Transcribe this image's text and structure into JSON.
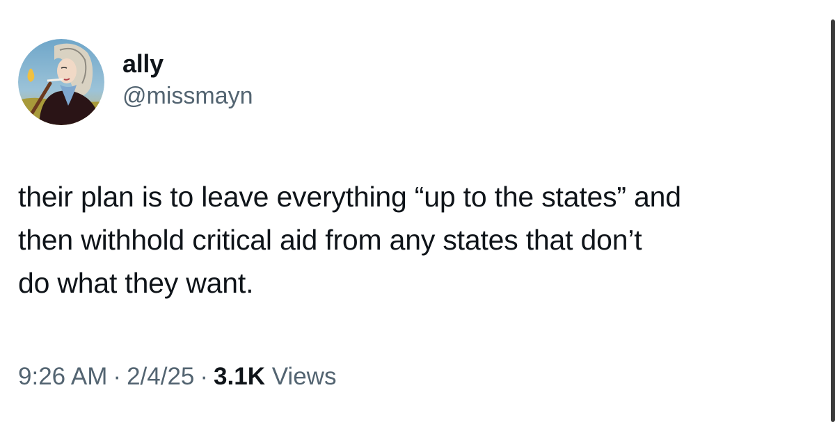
{
  "author": {
    "display_name": "ally",
    "handle": "@missmayn"
  },
  "tweet": {
    "text": "their plan is to leave everything “up to the states” and\nthen withhold critical aid from any states that don’t\ndo what they want."
  },
  "meta": {
    "time": "9:26 AM",
    "separator": "·",
    "date": "2/4/25",
    "views_count": "3.1K",
    "views_label": "Views"
  },
  "colors": {
    "text_primary": "#0f1419",
    "text_secondary": "#536471",
    "background": "#ffffff"
  },
  "icons": {
    "avatar": "profile-photo"
  }
}
